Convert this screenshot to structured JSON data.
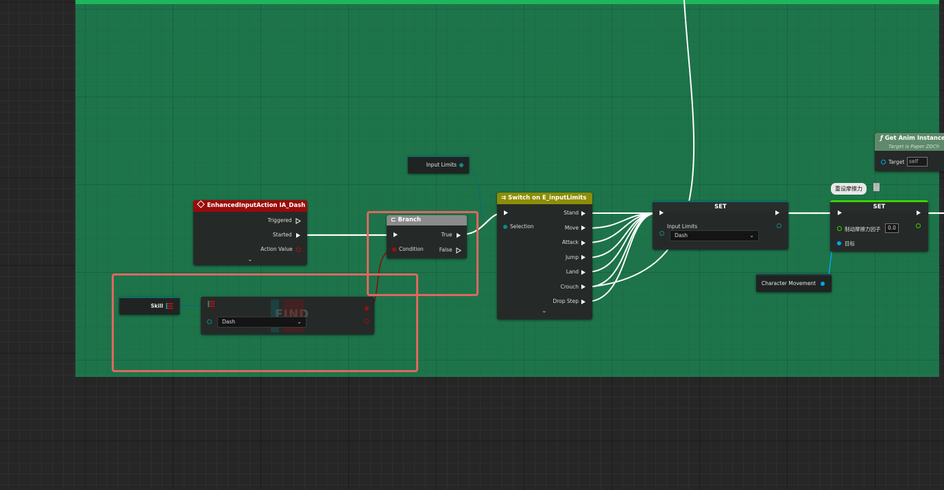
{
  "comment": {
    "title": ""
  },
  "colors": {
    "exec_wire": "#ffffff",
    "enum_pin": "#0e6d6d",
    "bool_pin": "#8c0a0a",
    "float_pin": "#38d500",
    "object_pin": "#00a8f2",
    "highlight": "#e06760"
  },
  "nodes": {
    "input_limits_getter": {
      "label": "Input Limits"
    },
    "enhanced_input": {
      "title": "EnhancedInputAction IA_Dash",
      "icon": "input-event-icon",
      "pins": {
        "triggered": "Triggered",
        "started": "Started",
        "action_value": "Action Value"
      }
    },
    "branch": {
      "title": "Branch",
      "icon": "branch-icon",
      "pins": {
        "condition": "Condition",
        "true": "True",
        "false": "False"
      }
    },
    "skill_getter": {
      "label": "Skill"
    },
    "find": {
      "watermark": "FIND",
      "dropdown_value": "Dash"
    },
    "switch": {
      "title": "Switch on E_inputLimits",
      "icon": "switch-icon",
      "selection": "Selection",
      "cases": [
        "Stand",
        "Move",
        "Attack",
        "Jump",
        "Land",
        "Crouch",
        "Drop Step"
      ]
    },
    "set_input_limits": {
      "title": "SET",
      "pin_label": "Input Limits",
      "dropdown_value": "Dash"
    },
    "character_movement": {
      "label": "Character Movement"
    },
    "reset_friction_comment": {
      "text": "重设摩擦力"
    },
    "set_friction": {
      "title": "SET",
      "float_label": "制动摩擦力因子",
      "float_value": "0.0",
      "target_label": "目标"
    },
    "get_anim_instance": {
      "title": "Get Anim Instance",
      "subtitle": "Target is Paper ZDCh",
      "target_label": "Target",
      "target_value": "self"
    }
  }
}
